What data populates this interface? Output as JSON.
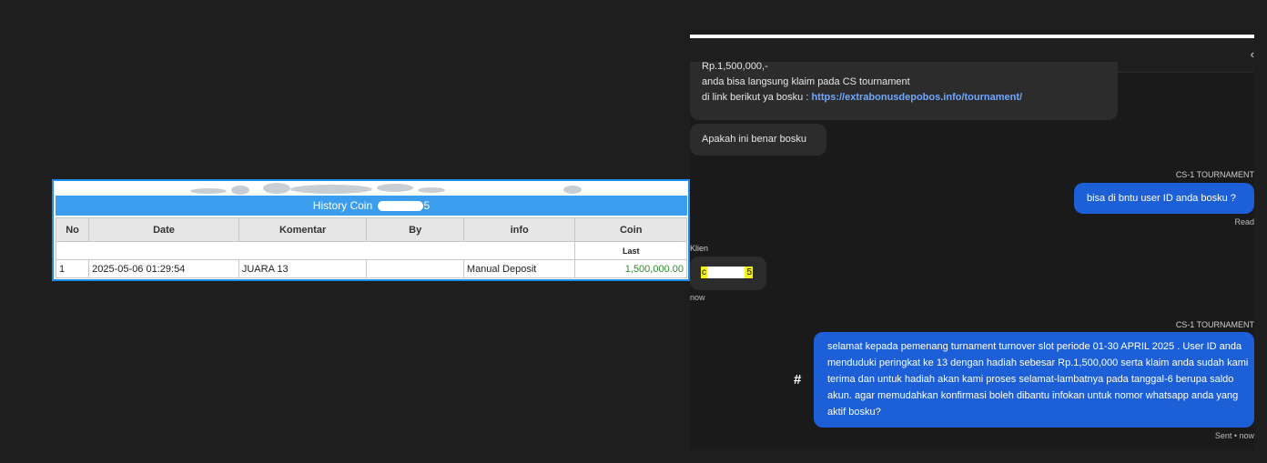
{
  "history": {
    "title_prefix": "History Coin",
    "title_suffix": "5",
    "columns": [
      "No",
      "Date",
      "Komentar",
      "By",
      "info",
      "Coin"
    ],
    "subheader": "Last",
    "rows": [
      {
        "no": "1",
        "date": "2025-05-06 01:29:54",
        "komentar": "JUARA 13",
        "by": "",
        "info": "Manual Deposit",
        "coin": "1,500,000.00"
      }
    ]
  },
  "chat": {
    "header_icon": "chevron-left-icon",
    "msg1": {
      "line1": "Rp.1,500,000,-",
      "line2": "anda bisa langsung klaim pada CS tournament",
      "line3_prefix": "di link berikut ya bosku :",
      "link": "https://extrabonusdepobos.info/tournament/"
    },
    "msg2": "Apakah ini benar bosku",
    "sender1": "CS-1 TOURNAMENT",
    "msg3": "bisa di bntu user ID anda bosku ?",
    "read": "Read",
    "klien": "Klien",
    "msg4_prefix": "c",
    "msg4_suffix": "5",
    "now": "now",
    "sender2": "CS-1 TOURNAMENT",
    "msg5": "selamat kepada pemenang turnament turnover slot periode 01-30 APRIL 2025 . User ID anda menduduki peringkat ke 13 dengan hadiah sebesar Rp.1,500,000 serta klaim anda sudah kami terima dan untuk hadiah akan kami proses selamat-lambatnya pada tanggal-6 berupa saldo akun. agar memudahkan konfirmasi boleh dibantu infokan untuk nomor whatsapp anda yang aktif bosku?",
    "sent": "Sent • now",
    "hash_icon": "#"
  },
  "colors": {
    "page_bg": "#1e1e1e",
    "table_border": "#1f8de6",
    "table_title_bg": "#3b9ded",
    "coin_green": "#2e8b2e",
    "bubble_out": "#1d5fd6",
    "bubble_in": "#2c2c2c",
    "link": "#6ea8ff",
    "highlight": "#f3f020"
  }
}
